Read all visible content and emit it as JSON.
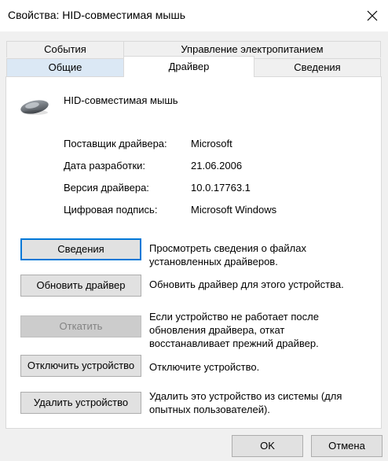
{
  "window": {
    "title": "Свойства: HID-совместимая мышь"
  },
  "tabs_back": [
    {
      "label": "События"
    },
    {
      "label": "Управление электропитанием"
    }
  ],
  "tabs_front": [
    {
      "label": "Общие"
    },
    {
      "label": "Драйвер"
    },
    {
      "label": "Сведения"
    }
  ],
  "active_tab": "Драйвер",
  "device": {
    "name": "HID-совместимая мышь",
    "icon": "mouse-icon"
  },
  "info": [
    {
      "label": "Поставщик драйвера:",
      "value": "Microsoft"
    },
    {
      "label": "Дата разработки:",
      "value": "21.06.2006"
    },
    {
      "label": "Версия драйвера:",
      "value": "10.0.17763.1"
    },
    {
      "label": "Цифровая подпись:",
      "value": "Microsoft Windows"
    }
  ],
  "actions": [
    {
      "label": "Сведения",
      "desc": [
        "Просмотреть сведения о файлах",
        "установленных драйверов."
      ],
      "enabled": true,
      "focused": true
    },
    {
      "label": "Обновить драйвер",
      "desc": [
        "Обновить драйвер для этого устройства."
      ],
      "enabled": true
    },
    {
      "label": "Откатить",
      "desc": [
        "Если устройство не работает после",
        "обновления драйвера, откат",
        "восстанавливает прежний драйвер."
      ],
      "enabled": false
    },
    {
      "label": "Отключить устройство",
      "desc": [
        "Отключите устройство."
      ],
      "enabled": true
    },
    {
      "label": "Удалить устройство",
      "desc": [
        "Удалить это устройство из системы (для",
        "опытных пользователей)."
      ],
      "enabled": true
    }
  ],
  "footer": {
    "ok": "OK",
    "cancel": "Отмена"
  }
}
